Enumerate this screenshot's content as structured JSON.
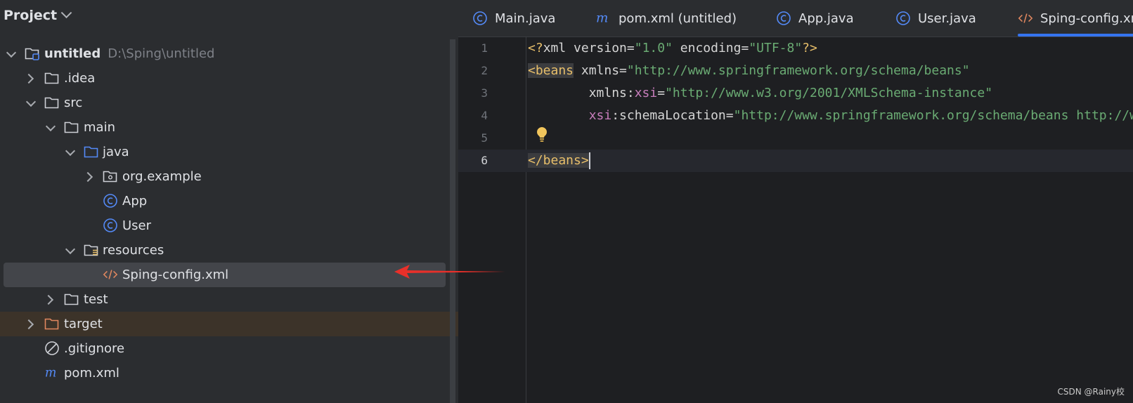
{
  "project_panel": {
    "title": "Project",
    "tree": [
      {
        "label": "untitled",
        "path": "D:\\Sping\\untitled",
        "icon": "module-folder-icon",
        "twisty": "open"
      },
      {
        "label": ".idea",
        "icon": "folder-icon",
        "twisty": "closed"
      },
      {
        "label": "src",
        "icon": "folder-icon",
        "twisty": "open"
      },
      {
        "label": "main",
        "icon": "folder-icon",
        "twisty": "open"
      },
      {
        "label": "java",
        "icon": "source-folder-icon",
        "twisty": "open"
      },
      {
        "label": "org.example",
        "icon": "package-icon",
        "twisty": "closed"
      },
      {
        "label": "App",
        "icon": "class-icon",
        "twisty": "none"
      },
      {
        "label": "User",
        "icon": "class-icon",
        "twisty": "none"
      },
      {
        "label": "resources",
        "icon": "resources-folder-icon",
        "twisty": "open"
      },
      {
        "label": "Sping-config.xml",
        "icon": "xml-file-icon",
        "twisty": "none",
        "selected": true
      },
      {
        "label": "test",
        "icon": "folder-icon",
        "twisty": "closed"
      },
      {
        "label": "target",
        "icon": "excluded-folder-icon",
        "twisty": "closed",
        "excluded": true
      },
      {
        "label": ".gitignore",
        "icon": "ignore-file-icon",
        "twisty": "none"
      },
      {
        "label": "pom.xml",
        "icon": "maven-file-icon",
        "twisty": "none"
      }
    ]
  },
  "tabs": [
    {
      "label": "Main.java",
      "icon": "class-icon"
    },
    {
      "label": "pom.xml (untitled)",
      "icon": "maven-file-icon"
    },
    {
      "label": "App.java",
      "icon": "class-icon"
    },
    {
      "label": "User.java",
      "icon": "class-icon"
    },
    {
      "label": "Sping-config.xml",
      "icon": "xml-file-icon",
      "active": true
    }
  ],
  "editor": {
    "line_numbers": [
      "1",
      "2",
      "3",
      "4",
      "5",
      "6"
    ],
    "current_line": 6,
    "code": {
      "l1_open": "<?",
      "l1_name": "xml",
      "l1_attr1": " version=",
      "l1_val1": "\"1.0\"",
      "l1_attr2": " encoding=",
      "l1_val2": "\"UTF-8\"",
      "l1_close": "?>",
      "l2_tag": "<beans",
      "l2_attr": " xmlns=",
      "l2_val": "\"http://www.springframework.org/schema/beans\"",
      "l3_indent": "       ",
      "l3_attr": " xmlns:",
      "l3_ns": "xsi",
      "l3_eq": "=",
      "l3_val": "\"http://www.w3.org/2001/XMLSchema-instance\"",
      "l4_indent": "        ",
      "l4_ns": "xsi",
      "l4_attr": ":schemaLocation=",
      "l4_val": "\"http://www.springframework.org/schema/beans http://www.springframework.org/schema/beans/spring-beans.xsd\"",
      "l6_tag": "</beans>"
    }
  },
  "watermark": "CSDN @Rainy校",
  "colors": {
    "accent": "#3574f0",
    "xml_tag": "#e8bf6a",
    "xml_string": "#6aab73",
    "xml_namespace": "#c77dbb",
    "annotation_arrow": "#e8302a"
  }
}
